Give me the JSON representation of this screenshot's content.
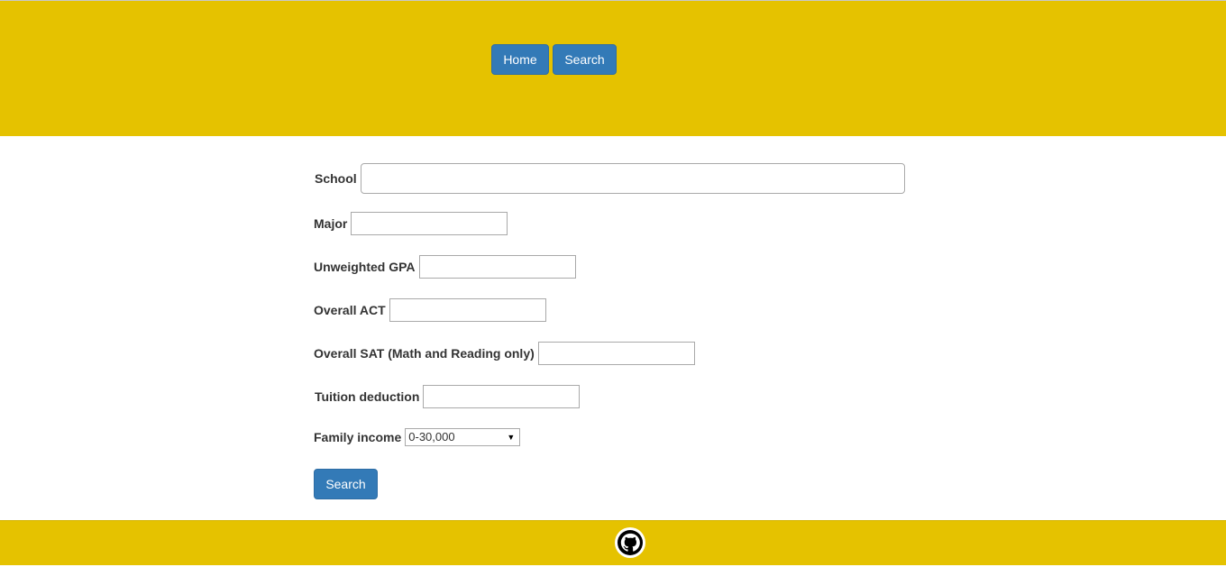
{
  "nav": {
    "home_label": "Home",
    "search_label": "Search"
  },
  "form": {
    "school_label": "School",
    "school_value": "",
    "major_label": "Major",
    "major_value": "",
    "gpa_label": "Unweighted GPA",
    "gpa_value": "",
    "act_label": "Overall ACT",
    "act_value": "",
    "sat_label": "Overall SAT (Math and Reading only)",
    "sat_value": "",
    "tuition_label": "Tuition deduction",
    "tuition_value": "",
    "income_label": "Family income",
    "income_selected": "0-30,000",
    "submit_label": "Search"
  },
  "footer": {
    "icon": "github-icon"
  },
  "colors": {
    "header_bg": "#e5c200",
    "button_bg": "#337ab7"
  }
}
